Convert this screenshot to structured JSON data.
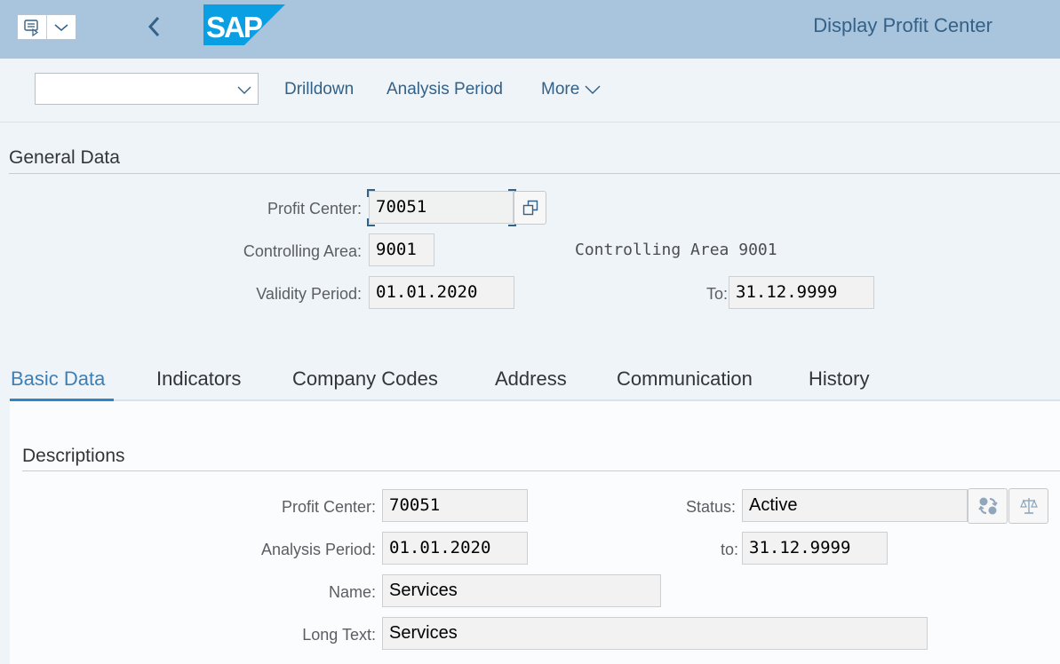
{
  "shell": {
    "title": "Display Profit Center",
    "logo_text": "SAP",
    "menu_icon": "command-field-icon",
    "dropdown_icon": "chevron-down-icon",
    "back_icon": "chevron-left-icon"
  },
  "toolbar": {
    "combo_value": "",
    "actions": [
      {
        "label": "Drilldown"
      },
      {
        "label": "Analysis Period"
      },
      {
        "label": "More"
      }
    ]
  },
  "general_data": {
    "title": "General Data",
    "profit_center_label": "Profit Center:",
    "profit_center_value": "70051",
    "controlling_area_label": "Controlling Area:",
    "controlling_area_value": "9001",
    "controlling_area_text": "Controlling Area 9001",
    "validity_period_label": "Validity Period:",
    "validity_from": "01.01.2020",
    "validity_to_label": "To:",
    "validity_to": "31.12.9999"
  },
  "tabs": [
    {
      "label": "Basic Data",
      "active": true
    },
    {
      "label": "Indicators",
      "active": false
    },
    {
      "label": "Company Codes",
      "active": false
    },
    {
      "label": "Address",
      "active": false
    },
    {
      "label": "Communication",
      "active": false
    },
    {
      "label": "History",
      "active": false
    }
  ],
  "descriptions": {
    "title": "Descriptions",
    "profit_center_label": "Profit Center:",
    "profit_center_value": "70051",
    "analysis_period_label": "Analysis Period:",
    "analysis_from": "01.01.2020",
    "analysis_to_label": "to:",
    "analysis_to": "31.12.9999",
    "status_label": "Status:",
    "status_value": "Active",
    "name_label": "Name:",
    "name_value": "Services",
    "long_text_label": "Long Text:",
    "long_text_value": "Services"
  },
  "colors": {
    "shell_bg": "#a9c5de",
    "accent": "#2b87c7",
    "link": "#346187",
    "sap_blue": "#0a9fe2"
  }
}
